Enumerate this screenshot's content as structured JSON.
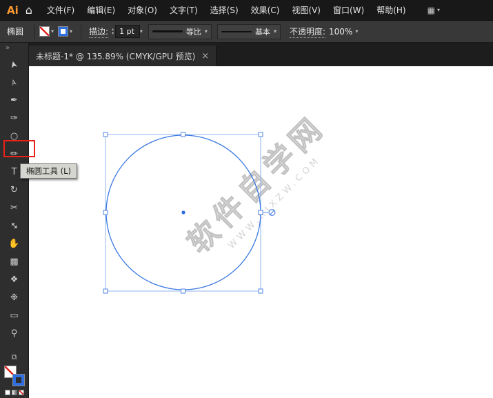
{
  "colors": {
    "selection_blue": "#2f6fe0",
    "highlight_red": "#ea2117",
    "logo_amber": "#ff9a33",
    "canvas": "#ffffff"
  },
  "icons": {
    "home": "⌂",
    "workspace": "▦",
    "caret": "▾",
    "spin_up": "▴",
    "spin_down": "▾",
    "expand": "»",
    "toggle": "⧉",
    "close": "×"
  },
  "menubar": {
    "logo": "Ai",
    "items": [
      {
        "label": "文件(F)"
      },
      {
        "label": "编辑(E)"
      },
      {
        "label": "对象(O)"
      },
      {
        "label": "文字(T)"
      },
      {
        "label": "选择(S)"
      },
      {
        "label": "效果(C)"
      },
      {
        "label": "视图(V)"
      },
      {
        "label": "窗口(W)"
      },
      {
        "label": "帮助(H)"
      }
    ]
  },
  "options": {
    "tool_name": "椭圆",
    "stroke_label": "描边:",
    "stroke_value": "1 pt",
    "profile_label": "等比",
    "brush_label": "基本",
    "opacity_label": "不透明度:",
    "opacity_value": "100%"
  },
  "tab": {
    "title": "未标题-1* @ 135.89% (CMYK/GPU 预览)"
  },
  "toolbar": {
    "tools": [
      {
        "name": "selection-tool",
        "glyph": "➤"
      },
      {
        "name": "direct-selection-tool",
        "glyph": "➢"
      },
      {
        "name": "pen-tool",
        "glyph": "✒"
      },
      {
        "name": "curvature-tool",
        "glyph": "✑"
      },
      {
        "name": "ellipse-tool",
        "glyph": "○"
      },
      {
        "name": "paintbrush-tool",
        "glyph": "✏"
      },
      {
        "name": "type-tool",
        "glyph": "T"
      },
      {
        "name": "rotate-tool",
        "glyph": "↻"
      },
      {
        "name": "scissors-tool",
        "glyph": "✂"
      },
      {
        "name": "scale-tool",
        "glyph": "↔"
      },
      {
        "name": "hand-tool",
        "glyph": "✋"
      },
      {
        "name": "gradient-tool",
        "glyph": "▩"
      },
      {
        "name": "blend-tool",
        "glyph": "❖"
      },
      {
        "name": "symbol-sprayer-tool",
        "glyph": "❉"
      },
      {
        "name": "artboard-tool",
        "glyph": "▭"
      },
      {
        "name": "zoom-tool",
        "glyph": "⚲"
      }
    ]
  },
  "tooltip": {
    "text": "椭圆工具 (L)"
  },
  "canvas": {
    "watermark_line1": "软件自学网",
    "watermark_line2": "WWW.RJXZW.COM"
  }
}
